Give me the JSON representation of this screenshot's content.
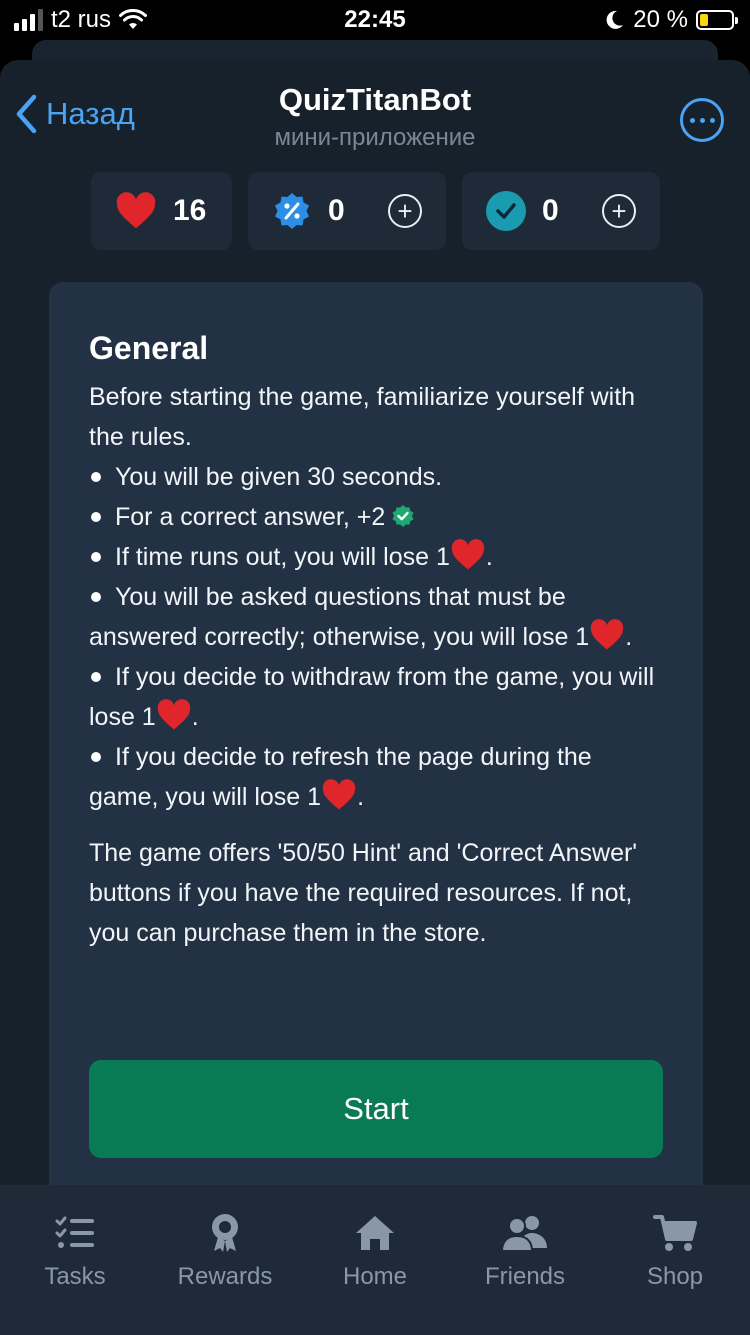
{
  "status_bar": {
    "carrier": "t2 rus",
    "time": "22:45",
    "battery": "20 %"
  },
  "header": {
    "back_label": "Назад",
    "title": "QuizTitanBot",
    "subtitle": "мини-приложение"
  },
  "resources": {
    "lives": "16",
    "hints": "0",
    "correct_answers": "0"
  },
  "card": {
    "title": "General",
    "intro": "Before starting the game, familiarize yourself with the rules.",
    "rules": [
      "You will be given 30 seconds.",
      "For a correct answer, +2",
      "If time runs out, you will lose 1",
      "You will be asked questions that must be answered correctly; otherwise, you will lose 1",
      "If you decide to withdraw from the game, you will lose 1",
      "If you decide to refresh the page during the game, you will lose 1"
    ],
    "rule_end": ".",
    "paragraph": "The game offers '50/50 Hint' and 'Correct Answer' buttons if you have the required resources. If not, you can purchase them in the store.",
    "start_label": "Start"
  },
  "nav": {
    "tasks": "Tasks",
    "rewards": "Rewards",
    "home": "Home",
    "friends": "Friends",
    "shop": "Shop"
  },
  "colors": {
    "background": "#17212b",
    "card": "#223244",
    "accent": "#4aa3f5",
    "start": "#087b55",
    "heart": "#e0262b"
  }
}
